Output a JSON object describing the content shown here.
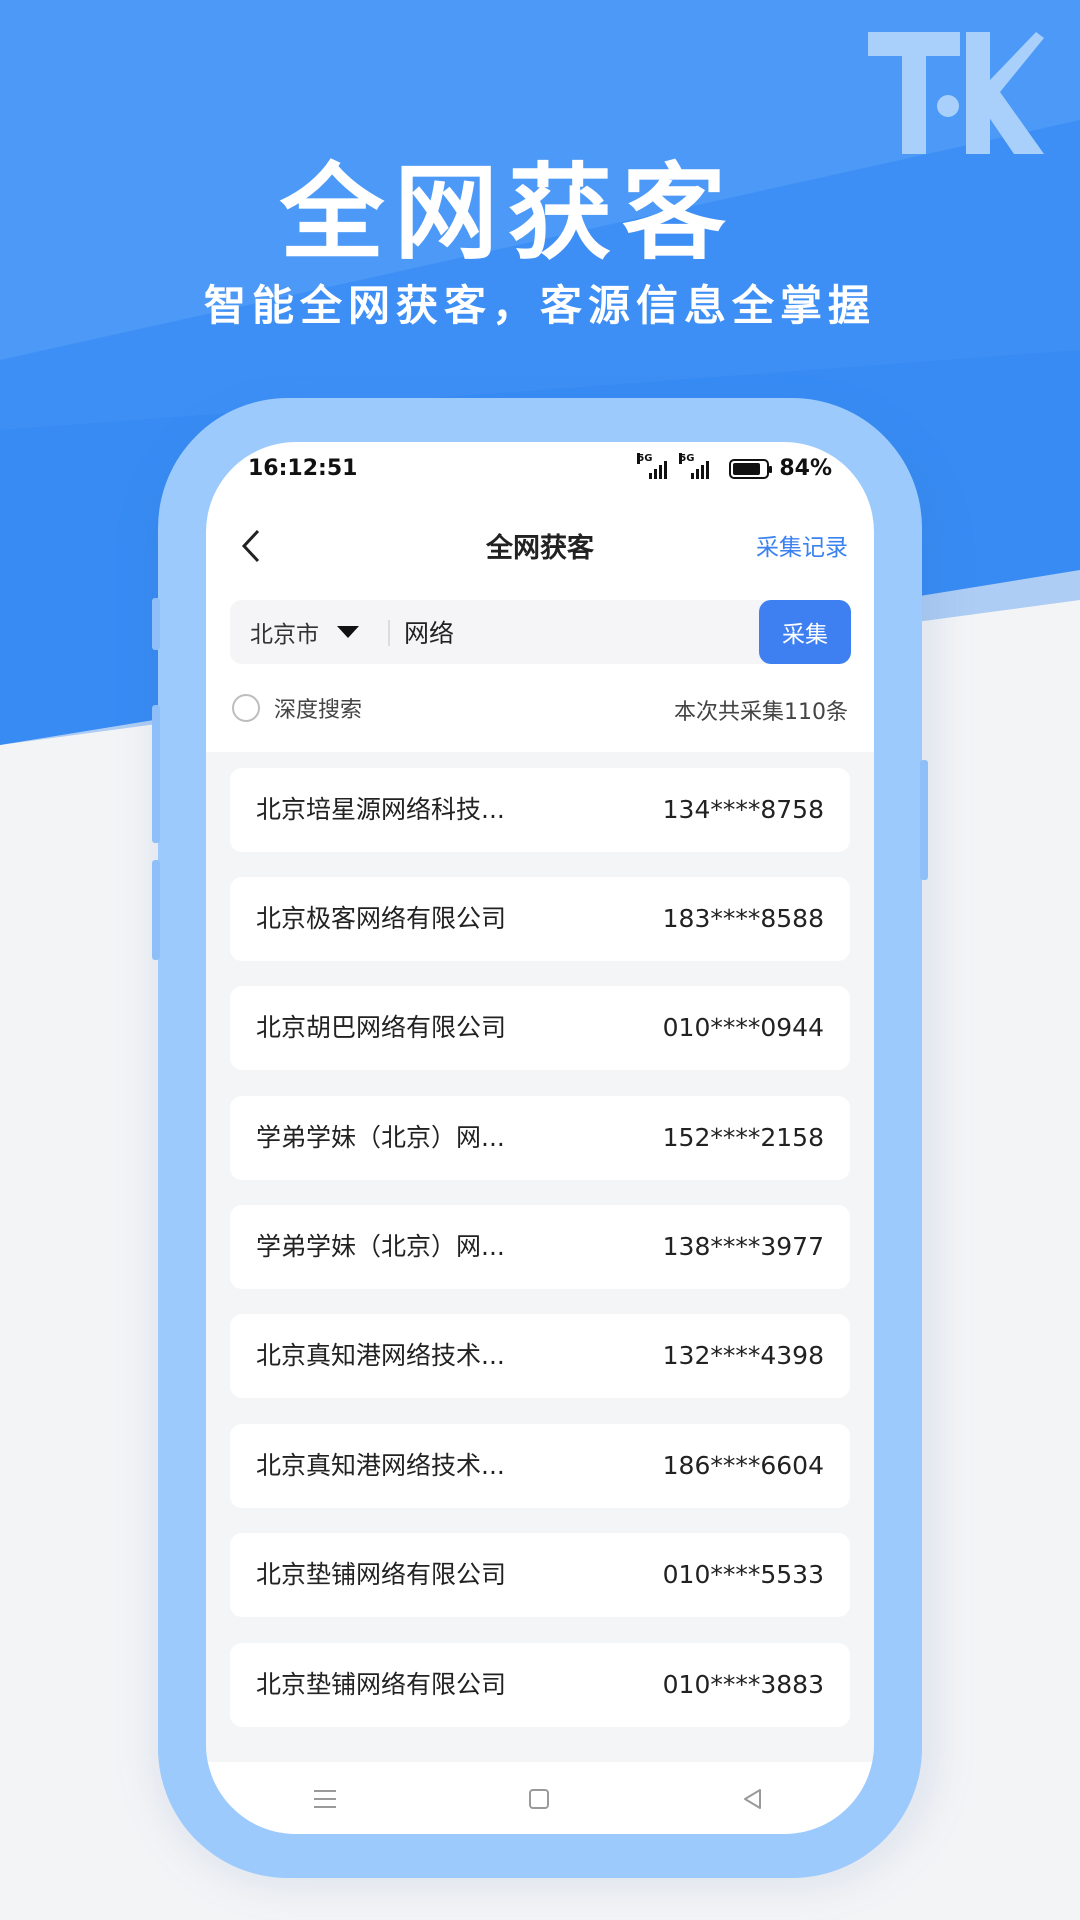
{
  "promo": {
    "title": "全网获客",
    "subtitle": "智能全网获客，客源信息全掌握",
    "logo_icon": "tk-logo-icon"
  },
  "status_bar": {
    "time": "16:12:51",
    "network_1": "5G",
    "network_2": "5G",
    "battery": "84%"
  },
  "nav": {
    "back_icon": "chevron-left-icon",
    "title": "全网获客",
    "record_link": "采集记录"
  },
  "search": {
    "city": "北京市",
    "query": "网络",
    "collect_button": "采集"
  },
  "options": {
    "deep_search_label": "深度搜索",
    "total_text": "本次共采集110条"
  },
  "results": [
    {
      "name": "北京培星源网络科技...",
      "phone": "134****8758"
    },
    {
      "name": "北京极客网络有限公司",
      "phone": "183****8588"
    },
    {
      "name": "北京胡巴网络有限公司",
      "phone": "010****0944"
    },
    {
      "name": "学弟学妹（北京）网...",
      "phone": "152****2158"
    },
    {
      "name": "学弟学妹（北京）网...",
      "phone": "138****3977"
    },
    {
      "name": "北京真知港网络技术...",
      "phone": "132****4398"
    },
    {
      "name": "北京真知港网络技术...",
      "phone": "186****6604"
    },
    {
      "name": "北京垫铺网络有限公司",
      "phone": "010****5533"
    },
    {
      "name": "北京垫铺网络有限公司",
      "phone": "010****3883"
    }
  ],
  "system_nav": {
    "menu_icon": "menu-icon",
    "home_icon": "home-icon",
    "back_icon": "back-triangle-icon"
  },
  "colors": {
    "brand_blue": "#3d8ff5",
    "button_blue": "#3e80f2",
    "frame_blue": "#9ccafd"
  }
}
